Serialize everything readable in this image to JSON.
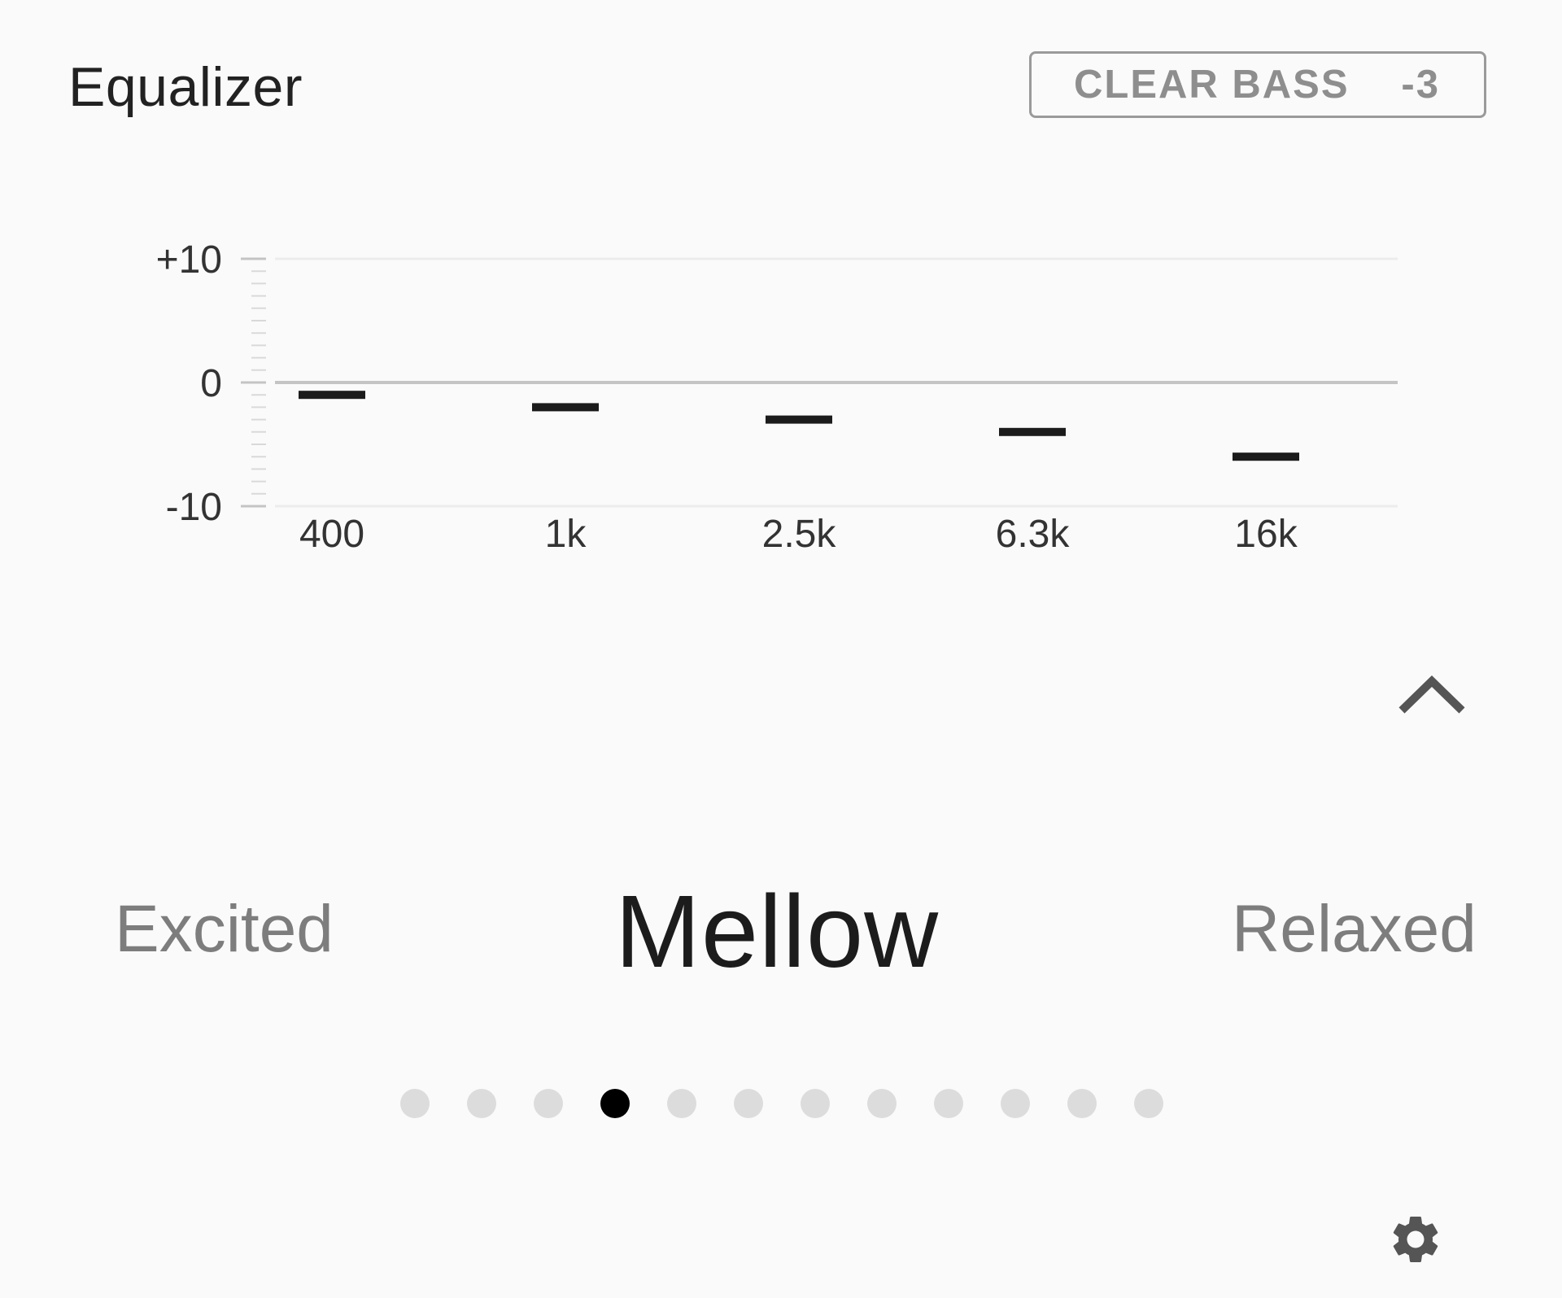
{
  "header": {
    "title": "Equalizer",
    "clear_bass_label": "CLEAR BASS",
    "clear_bass_value": "-3"
  },
  "chart_data": {
    "type": "bar",
    "categories": [
      "400",
      "1k",
      "2.5k",
      "6.3k",
      "16k"
    ],
    "values": [
      -1,
      -2,
      -3,
      -4,
      -6
    ],
    "ylim": [
      -10,
      10
    ],
    "yticks": [
      "+10",
      "0",
      "-10"
    ],
    "title": "",
    "xlabel": "",
    "ylabel": ""
  },
  "presets": {
    "previous": "Excited",
    "current": "Mellow",
    "next": "Relaxed",
    "count": 12,
    "active_index": 3
  },
  "icons": {
    "collapse": "chevron-up-icon",
    "settings": "gear-icon"
  },
  "colors": {
    "background": "#fafafa",
    "text": "#1f1f1f",
    "muted": "#7d7d7d",
    "dot_inactive": "#dcdcdc",
    "dot_active": "#000000"
  }
}
